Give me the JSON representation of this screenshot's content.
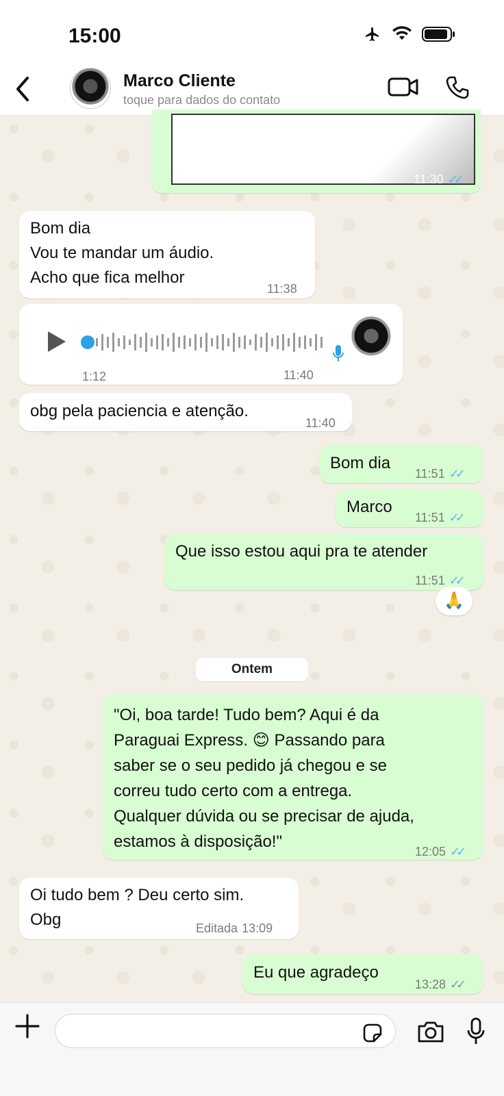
{
  "status_bar": {
    "time": "15:00"
  },
  "header": {
    "contact_name": "Marco Cliente",
    "subtitle": "toque para dados do contato"
  },
  "messages": {
    "m0_time": "11:30",
    "m1_lines": [
      "Bom dia",
      "Vou te mandar um áudio.",
      "Acho que fica melhor"
    ],
    "m1_time": "11:38",
    "voice_duration": "1:12",
    "voice_time": "11:40",
    "m3_text": "obg pela paciencia e atenção.",
    "m3_time": "11:40",
    "m4_text": "Bom dia",
    "m4_time": "11:51",
    "m5_text": "Marco",
    "m5_time": "11:51",
    "m6_text": "Que isso estou aqui pra te atender",
    "m6_time": "11:51",
    "m6_reaction": "🙏",
    "date_divider": "Ontem",
    "m7_lines": [
      "\"Oi, boa tarde! Tudo bem? Aqui é da",
      "Paraguai Express. 😊 Passando para",
      "saber se o seu pedido já chegou e se",
      "correu tudo certo com a entrega.",
      "Qualquer dúvida ou se precisar de ajuda,",
      "estamos à disposição!\""
    ],
    "m7_time": "12:05",
    "m8_lines": [
      "Oi tudo bem ? Deu certo sim.",
      "Obg"
    ],
    "m8_edited": "Editada",
    "m8_time": "13:09",
    "m9_text": "Eu que agradeço",
    "m9_time": "13:28"
  },
  "colors": {
    "incoming": "#ffffff",
    "outgoing": "#d9fdd3",
    "read_ticks": "#53bdeb",
    "unread_ticks": "#8696a0"
  },
  "icons": [
    "back-chevron-icon",
    "video-call-icon",
    "voice-call-icon",
    "play-icon",
    "mic-icon",
    "plus-icon",
    "sticker-icon",
    "camera-icon"
  ]
}
